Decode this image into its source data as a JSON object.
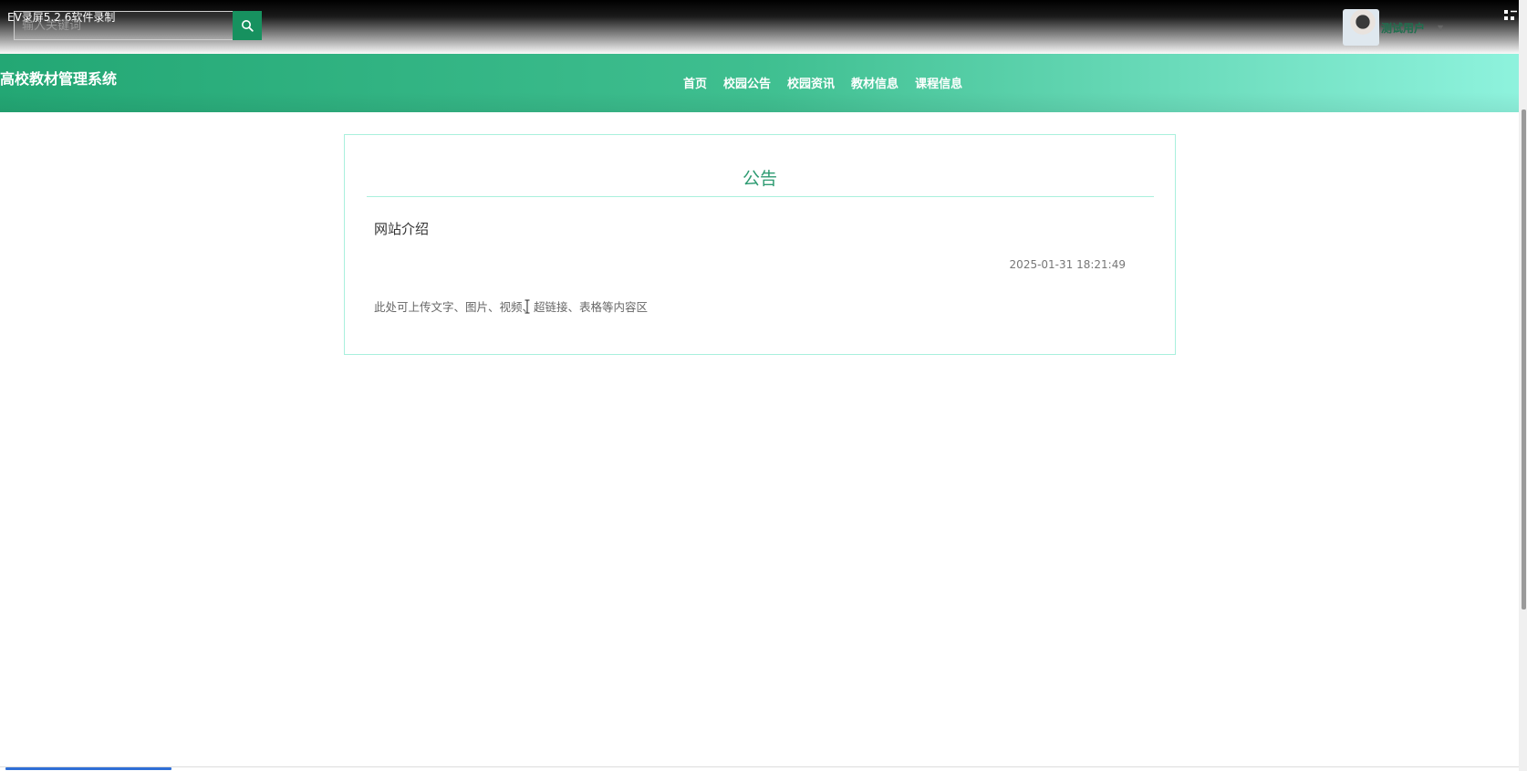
{
  "recorder": {
    "title": "EV录屏5.2.6软件录制"
  },
  "search": {
    "placeholder": "输入关键词"
  },
  "user": {
    "name": "测试用户"
  },
  "header": {
    "site_title": "高校教材管理系统",
    "nav": [
      "首页",
      "校园公告",
      "校园资讯",
      "教材信息",
      "课程信息"
    ]
  },
  "card": {
    "heading": "公告",
    "article_title": "网站介绍",
    "date": "2025-01-31 18:21:49",
    "body": "此处可上传文字、图片、视频、超链接、表格等内容区"
  },
  "progress": {
    "fraction": 0.11
  },
  "colors": {
    "accent_green": "#17915f",
    "header_start": "#23a774",
    "header_end": "#8ff3de",
    "card_border": "#a9f0dd"
  },
  "icons": [
    "search-icon",
    "fullscreen-icon",
    "caret-down-icon",
    "text-cursor-icon"
  ]
}
